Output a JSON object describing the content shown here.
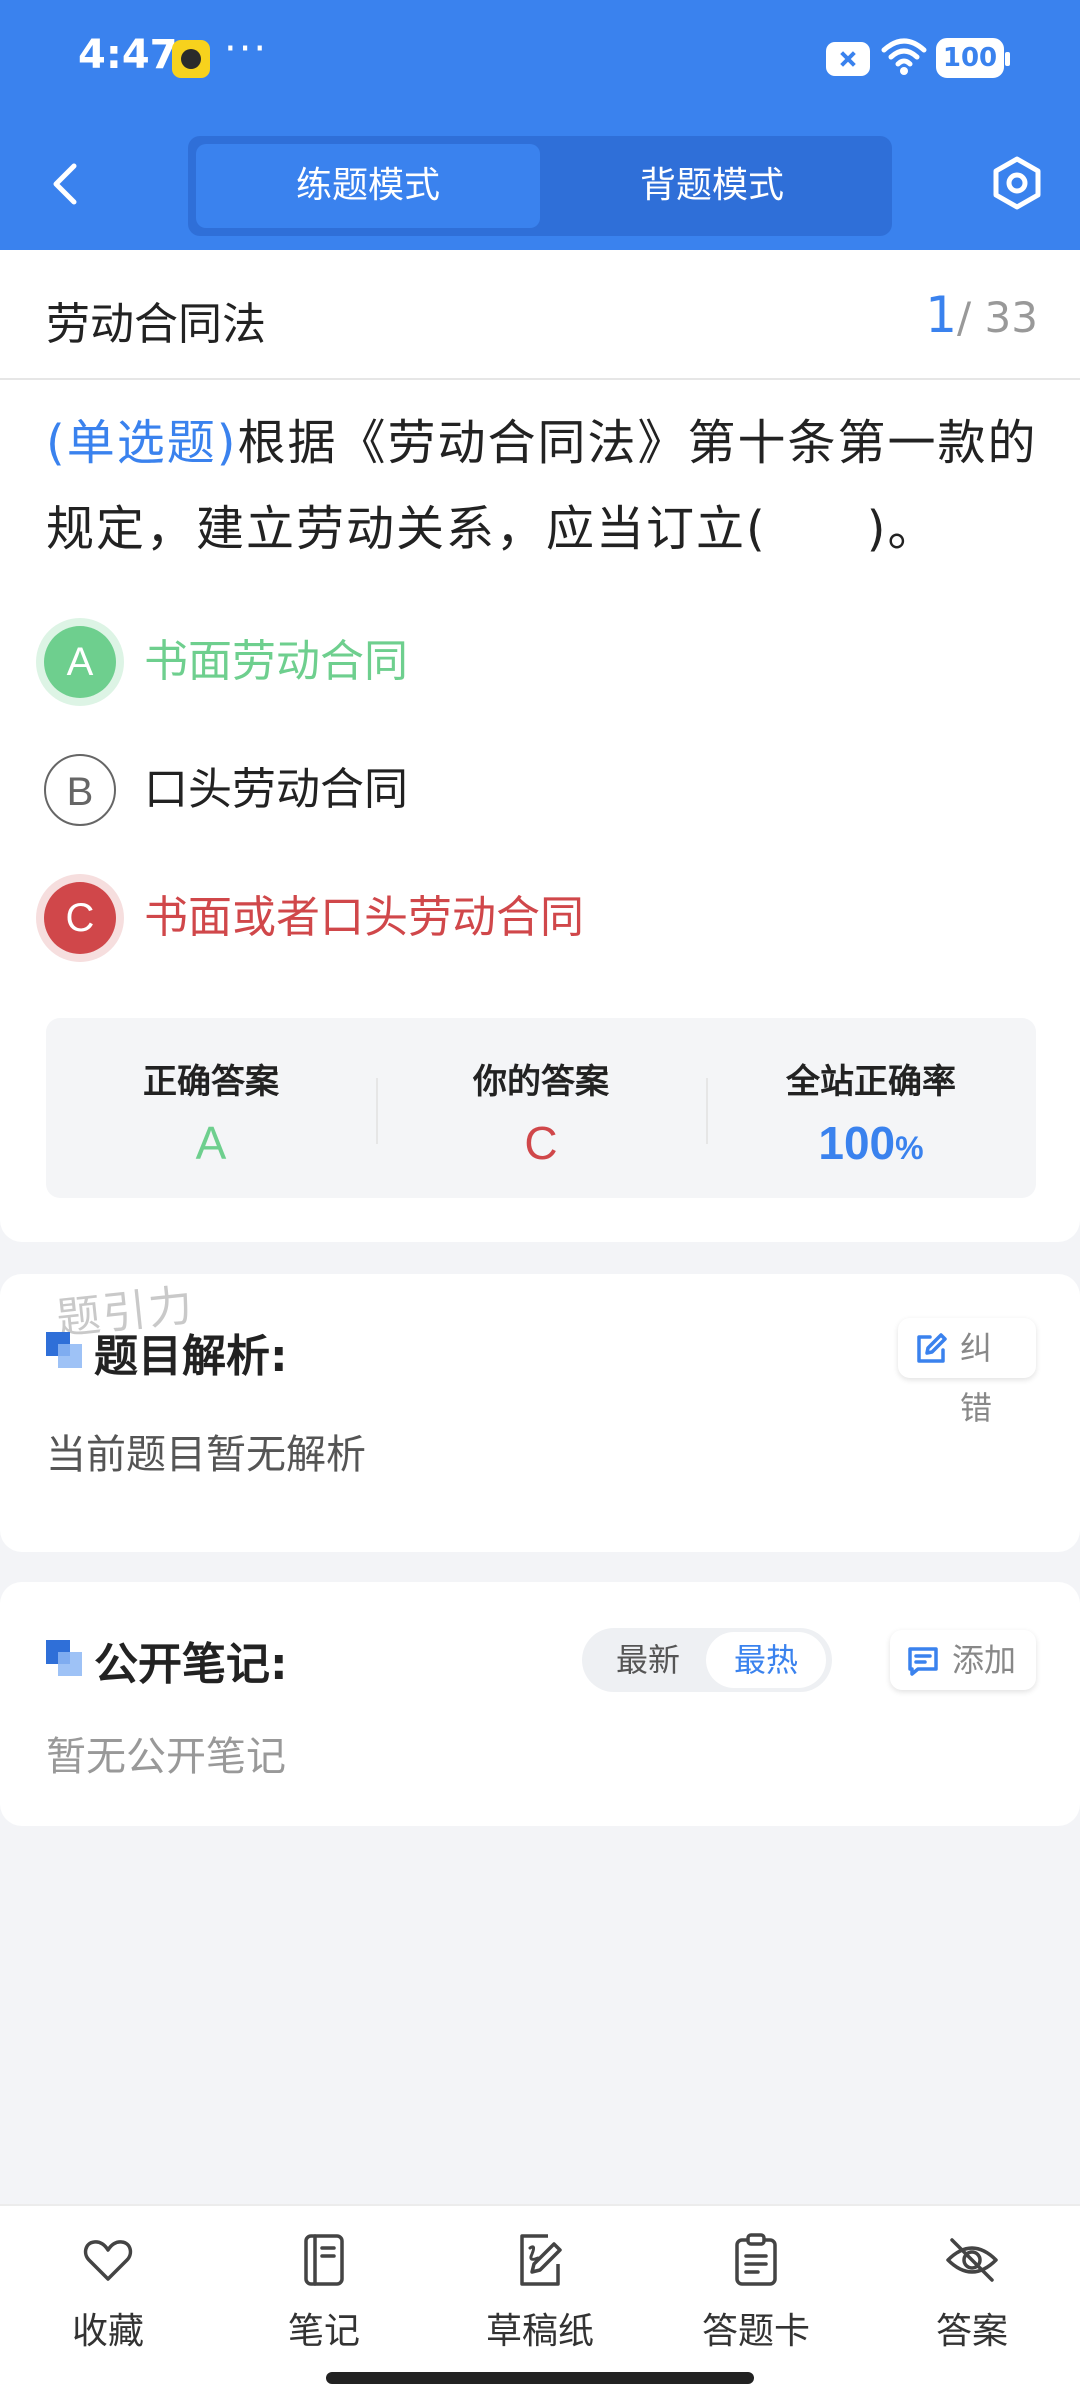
{
  "status_bar": {
    "time": "4:47",
    "dots": "···",
    "battery": "100"
  },
  "header": {
    "tabs": [
      {
        "label": "练题模式",
        "active": true
      },
      {
        "label": "背题模式",
        "active": false
      }
    ]
  },
  "question": {
    "chapter": "劳动合同法",
    "current": "1",
    "total": "/ 33",
    "type": "(单选题)",
    "text": "根据《劳动合同法》第十条第一款的规定，建立劳动关系，应当订立(　　)。",
    "options": [
      {
        "letter": "A",
        "text": "书面劳动合同",
        "state": "correct"
      },
      {
        "letter": "B",
        "text": "口头劳动合同",
        "state": "neutral"
      },
      {
        "letter": "C",
        "text": "书面或者口头劳动合同",
        "state": "wrong"
      }
    ]
  },
  "stats": {
    "correct_label": "正确答案",
    "correct_value": "A",
    "yours_label": "你的答案",
    "yours_value": "C",
    "rate_label": "全站正确率",
    "rate_value": "100",
    "rate_unit": "%"
  },
  "analysis": {
    "watermark": "题引力",
    "title": "题目解析:",
    "correct_btn": "纠错",
    "body": "当前题目暂无解析"
  },
  "notes": {
    "title": "公开笔记:",
    "sort_options": [
      "最新",
      "最热"
    ],
    "sort_active": "最热",
    "add_btn": "添加",
    "body": "暂无公开笔记"
  },
  "bottom_nav": [
    {
      "label": "收藏",
      "icon": "heart-icon"
    },
    {
      "label": "笔记",
      "icon": "notebook-icon"
    },
    {
      "label": "草稿纸",
      "icon": "draft-paper-icon"
    },
    {
      "label": "答题卡",
      "icon": "answer-card-icon"
    },
    {
      "label": "答案",
      "icon": "eye-off-icon"
    }
  ],
  "colors": {
    "brand_blue": "#3a82ee",
    "correct_green": "#6ecf8e",
    "wrong_red": "#d0474a"
  }
}
